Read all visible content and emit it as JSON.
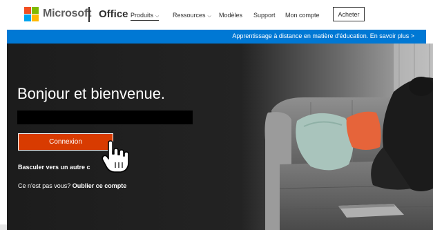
{
  "header": {
    "brand": "Microsoft",
    "product": "Office",
    "nav": {
      "produits": "Produits",
      "ressources": "Ressources",
      "modeles": "Modèles",
      "support": "Support",
      "mon_compte": "Mon compte"
    },
    "buy_label": "Acheter",
    "logo_colors": [
      "#f25022",
      "#7fba00",
      "#00a4ef",
      "#ffb900"
    ]
  },
  "banner": {
    "text": "Apprentissage à distance en matière d'éducation. En savoir plus >",
    "color": "#0078d4"
  },
  "hero": {
    "title": "Bonjour et bienvenue.",
    "signin_label": "Connexion",
    "switch_account": "Basculer vers un autre c",
    "not_you": "Ce n'est pas vous?",
    "forget_account": "Oublier ce compte",
    "signin_color": "#d83b01"
  },
  "icons": {
    "chevron": "chevron-down-icon",
    "cursor": "hand-pointer-icon"
  }
}
